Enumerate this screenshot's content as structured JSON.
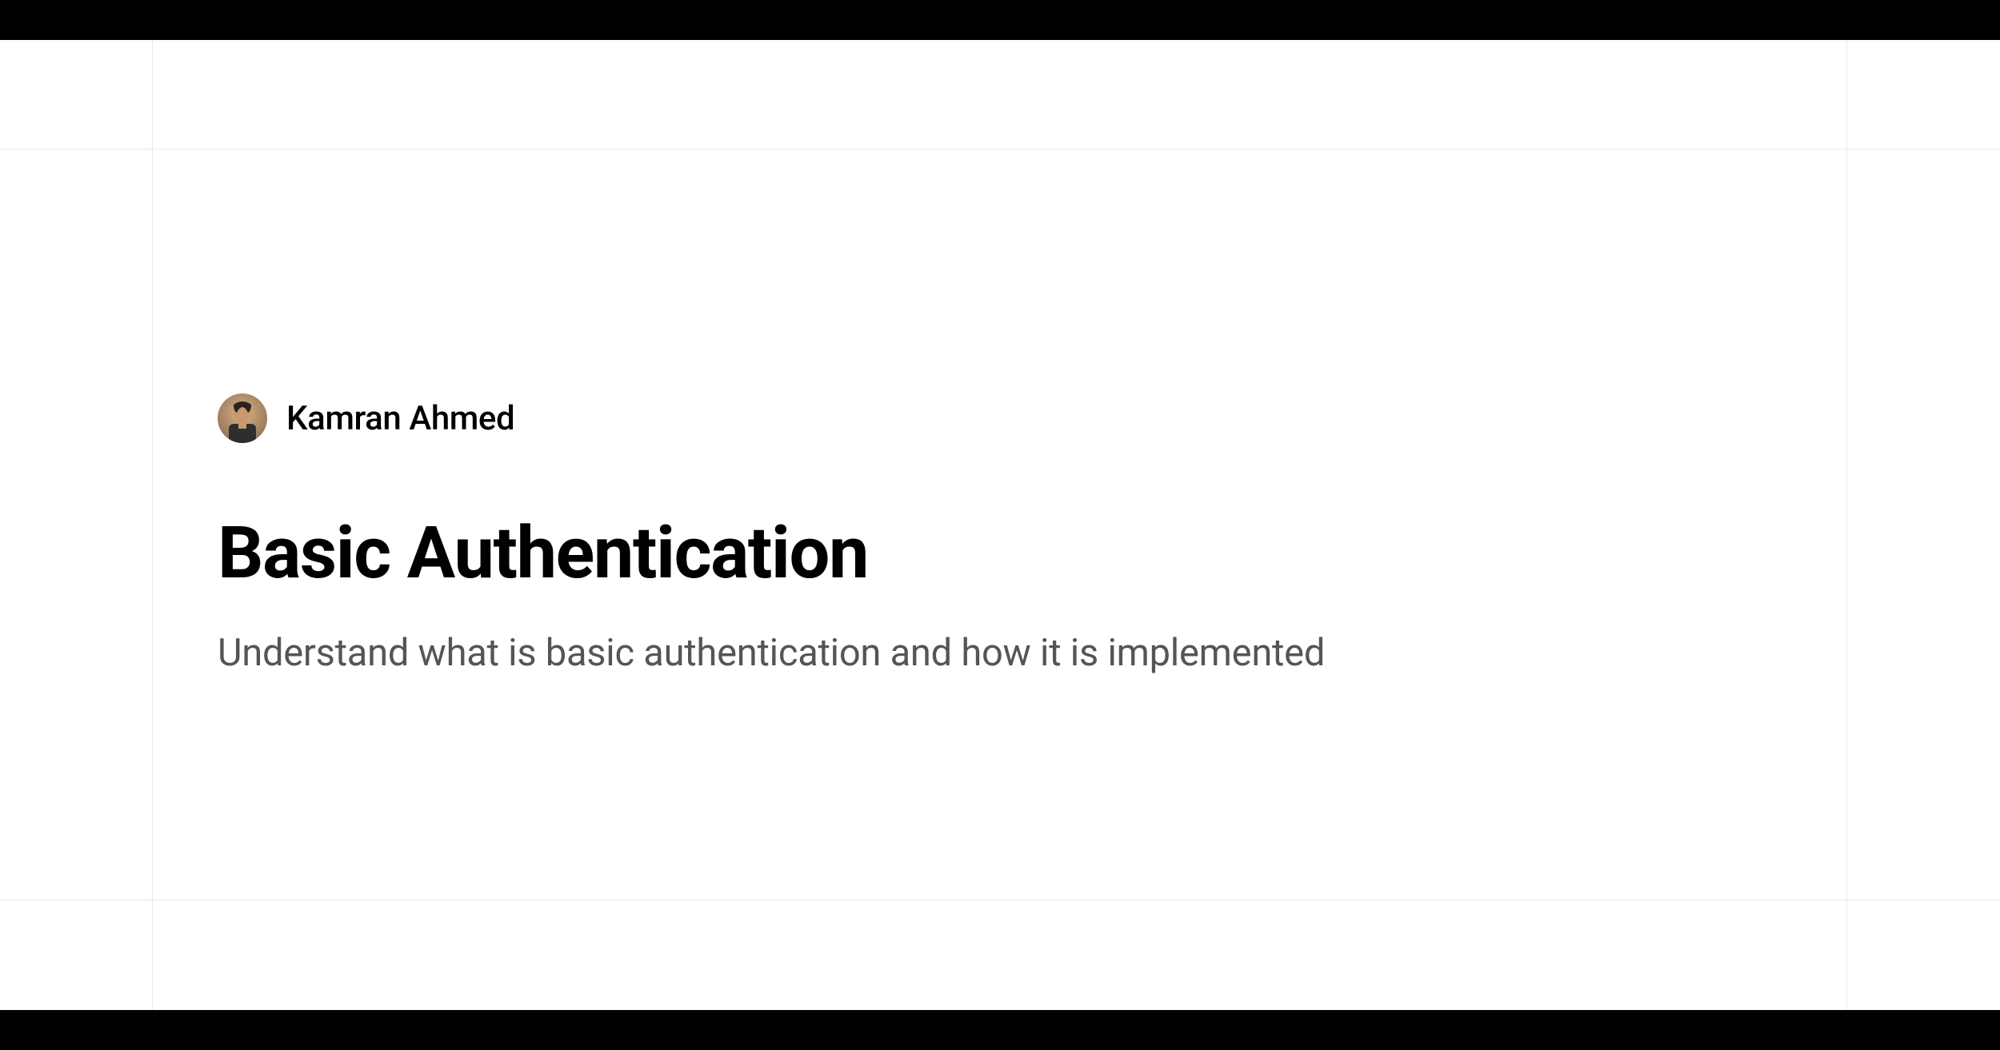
{
  "author": {
    "name": "Kamran Ahmed"
  },
  "title": "Basic Authentication",
  "subtitle": "Understand what is basic authentication and how it is implemented"
}
